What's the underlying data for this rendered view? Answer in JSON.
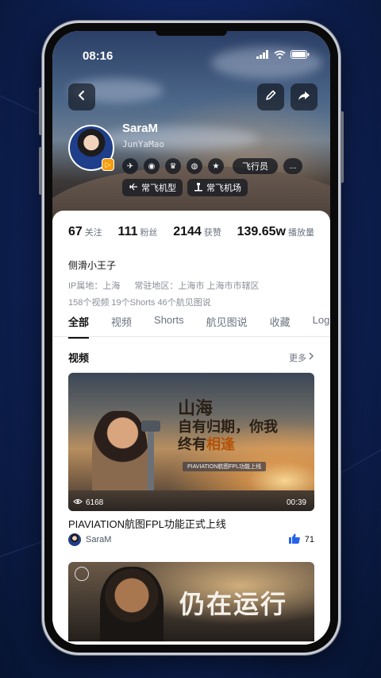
{
  "status": {
    "time": "08:16"
  },
  "profile": {
    "name": "SaraM",
    "handle": "JunYaMao",
    "role": "飞行员",
    "more": "...",
    "chips": [
      "常飞机型",
      "常飞机场"
    ]
  },
  "stats": [
    {
      "value": "67",
      "label": "关注"
    },
    {
      "value": "111",
      "label": "粉丝"
    },
    {
      "value": "2144",
      "label": "获赞"
    },
    {
      "value": "139.65w",
      "label": "播放量"
    }
  ],
  "bio": "侧滑小王子",
  "meta": {
    "ip": "IP属地：上海",
    "region": "常驻地区：上海市 上海市市辖区",
    "counts": "158个视频  19个Shorts  46个航见图说"
  },
  "tabs": [
    "全部",
    "视频",
    "Shorts",
    "航见图说",
    "收藏",
    "Log"
  ],
  "section": {
    "title": "视频",
    "more": "更多"
  },
  "video1": {
    "headline_l1": "山海",
    "headline_l2": "自有归期，你我",
    "headline_l3a": "终有",
    "headline_l3b": "相逢",
    "strip": "PIAVIATION航图FPL功能上线",
    "views": "6168",
    "duration": "00:39",
    "title": "PIAVIATION航图FPL功能正式上线",
    "author": "SaraM",
    "likes": "71"
  },
  "video2": {
    "headline": "仍在运行"
  }
}
